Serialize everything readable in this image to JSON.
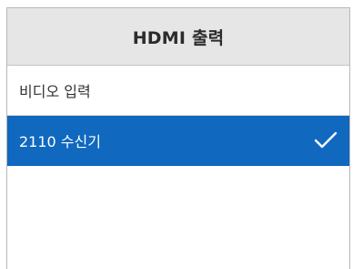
{
  "header": {
    "title": "HDMI 출력"
  },
  "menu": {
    "items": [
      {
        "label": "비디오 입력",
        "selected": false
      },
      {
        "label": "2110 수신기",
        "selected": true
      }
    ]
  },
  "icons": {
    "selected_indicator": "checkmark-icon"
  },
  "colors": {
    "header_bg": "#e6e6e6",
    "selected_bg": "#1068bf",
    "selected_text": "#ffffff",
    "text": "#333333"
  }
}
